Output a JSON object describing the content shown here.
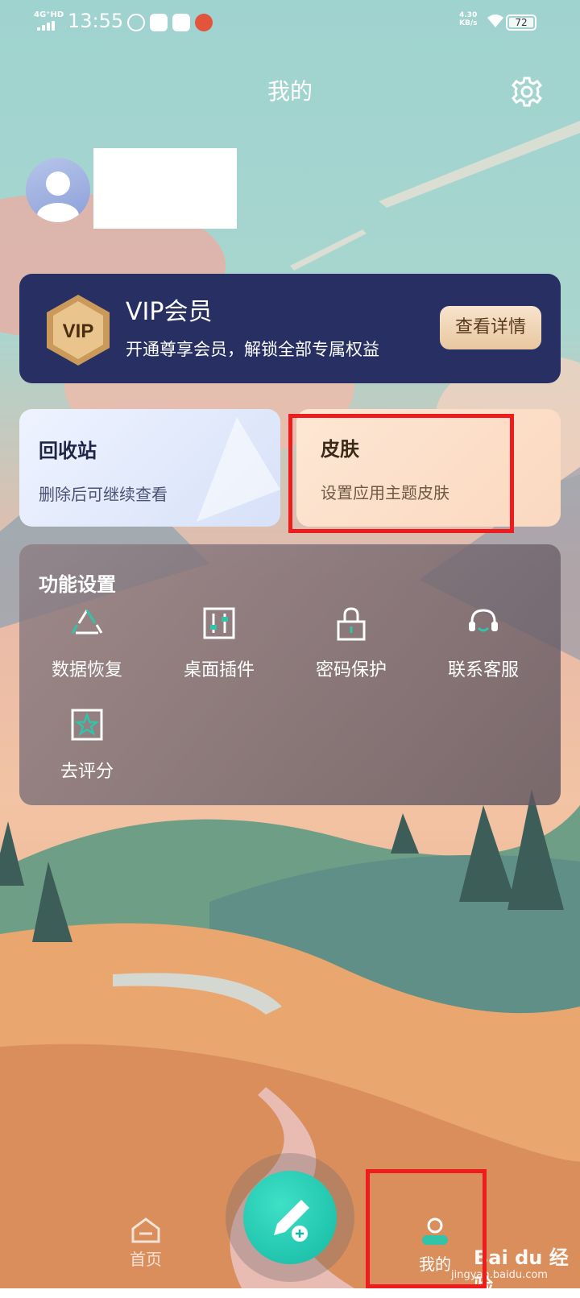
{
  "status_bar": {
    "network": "4G⁺HD",
    "time": "13:55",
    "speed_top": "4.30",
    "speed_unit": "KB/s",
    "battery": "72"
  },
  "header": {
    "title": "我的"
  },
  "vip": {
    "badge_text": "VIP",
    "title": "VIP会员",
    "description": "开通尊享会员，解锁全部专属权益",
    "button_label": "查看详情"
  },
  "recycle": {
    "title": "回收站",
    "description": "删除后可继续查看"
  },
  "skin": {
    "title": "皮肤",
    "description": "设置应用主题皮肤"
  },
  "functions": {
    "title": "功能设置",
    "items": [
      {
        "label": "数据恢复",
        "icon": "recycle-icon"
      },
      {
        "label": "桌面插件",
        "icon": "sliders-icon"
      },
      {
        "label": "密码保护",
        "icon": "lock-icon"
      },
      {
        "label": "联系客服",
        "icon": "headset-icon"
      },
      {
        "label": "去评分",
        "icon": "star-icon"
      }
    ]
  },
  "bottom_nav": {
    "home_label": "首页",
    "mine_label": "我的",
    "fab_icon": "edit-add-icon"
  },
  "watermark": {
    "brand": "Bai du 经验",
    "url": "jingyan.baidu.com"
  },
  "colors": {
    "vip_bg": "#272f63",
    "fab": "#1cc6ad",
    "highlight": "#ee1c1c"
  }
}
